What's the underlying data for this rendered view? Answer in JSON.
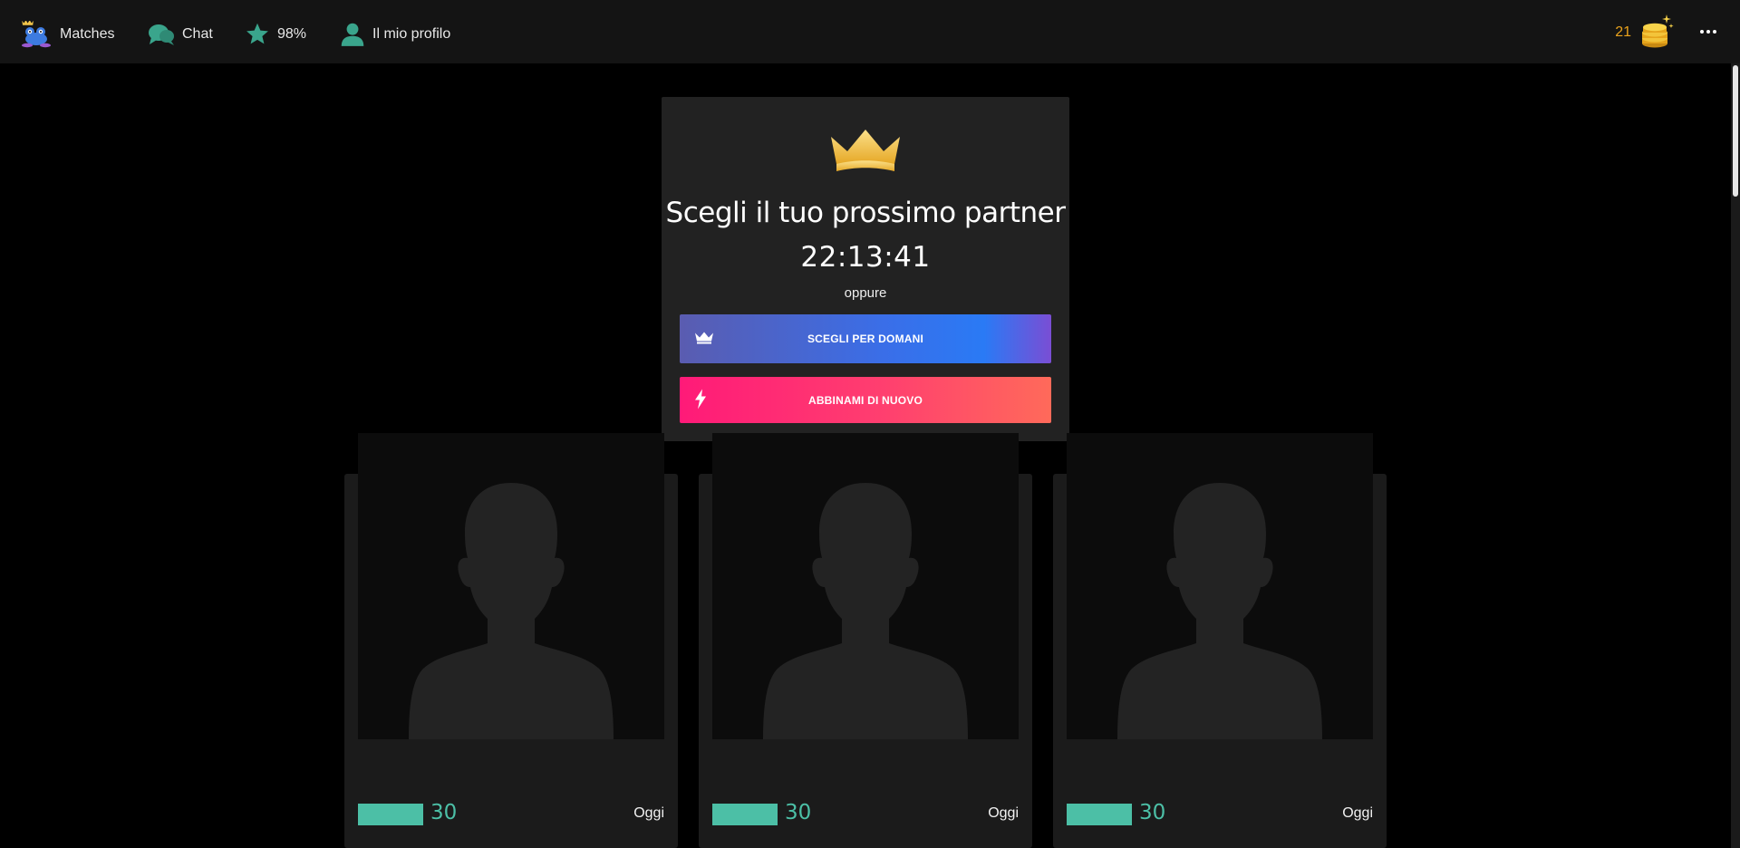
{
  "topbar": {
    "nav": [
      {
        "label": "Matches",
        "icon": "frog-mascot-icon"
      },
      {
        "label": "Chat",
        "icon": "chat-bubbles-icon"
      },
      {
        "label": "98%",
        "icon": "star-icon"
      },
      {
        "label": "Il mio profilo",
        "icon": "user-icon"
      }
    ],
    "coins": {
      "count": "21",
      "icon": "coin-stack-icon"
    },
    "more_icon": "more-horizontal-icon"
  },
  "panel": {
    "icon": "crown-icon",
    "title": "Scegli il tuo prossimo partner",
    "countdown": "22:13:41",
    "separator": "oppure",
    "buttons": [
      {
        "label": "SCEGLI PER DOMANI",
        "icon": "crown-icon"
      },
      {
        "label": "ABBINAMI DI NUOVO",
        "icon": "lightning-icon"
      }
    ]
  },
  "cards": [
    {
      "score": "30",
      "when": "Oggi",
      "photo": "avatar-placeholder"
    },
    {
      "score": "30",
      "when": "Oggi",
      "photo": "avatar-placeholder"
    },
    {
      "score": "30",
      "when": "Oggi",
      "photo": "avatar-placeholder"
    }
  ],
  "colors": {
    "accent_teal": "#4cbfa6",
    "coin_orange": "#e9a21c",
    "pink": "#ff1a78",
    "blue": "#2a7af5",
    "crown_gold": "#f3c64a"
  }
}
